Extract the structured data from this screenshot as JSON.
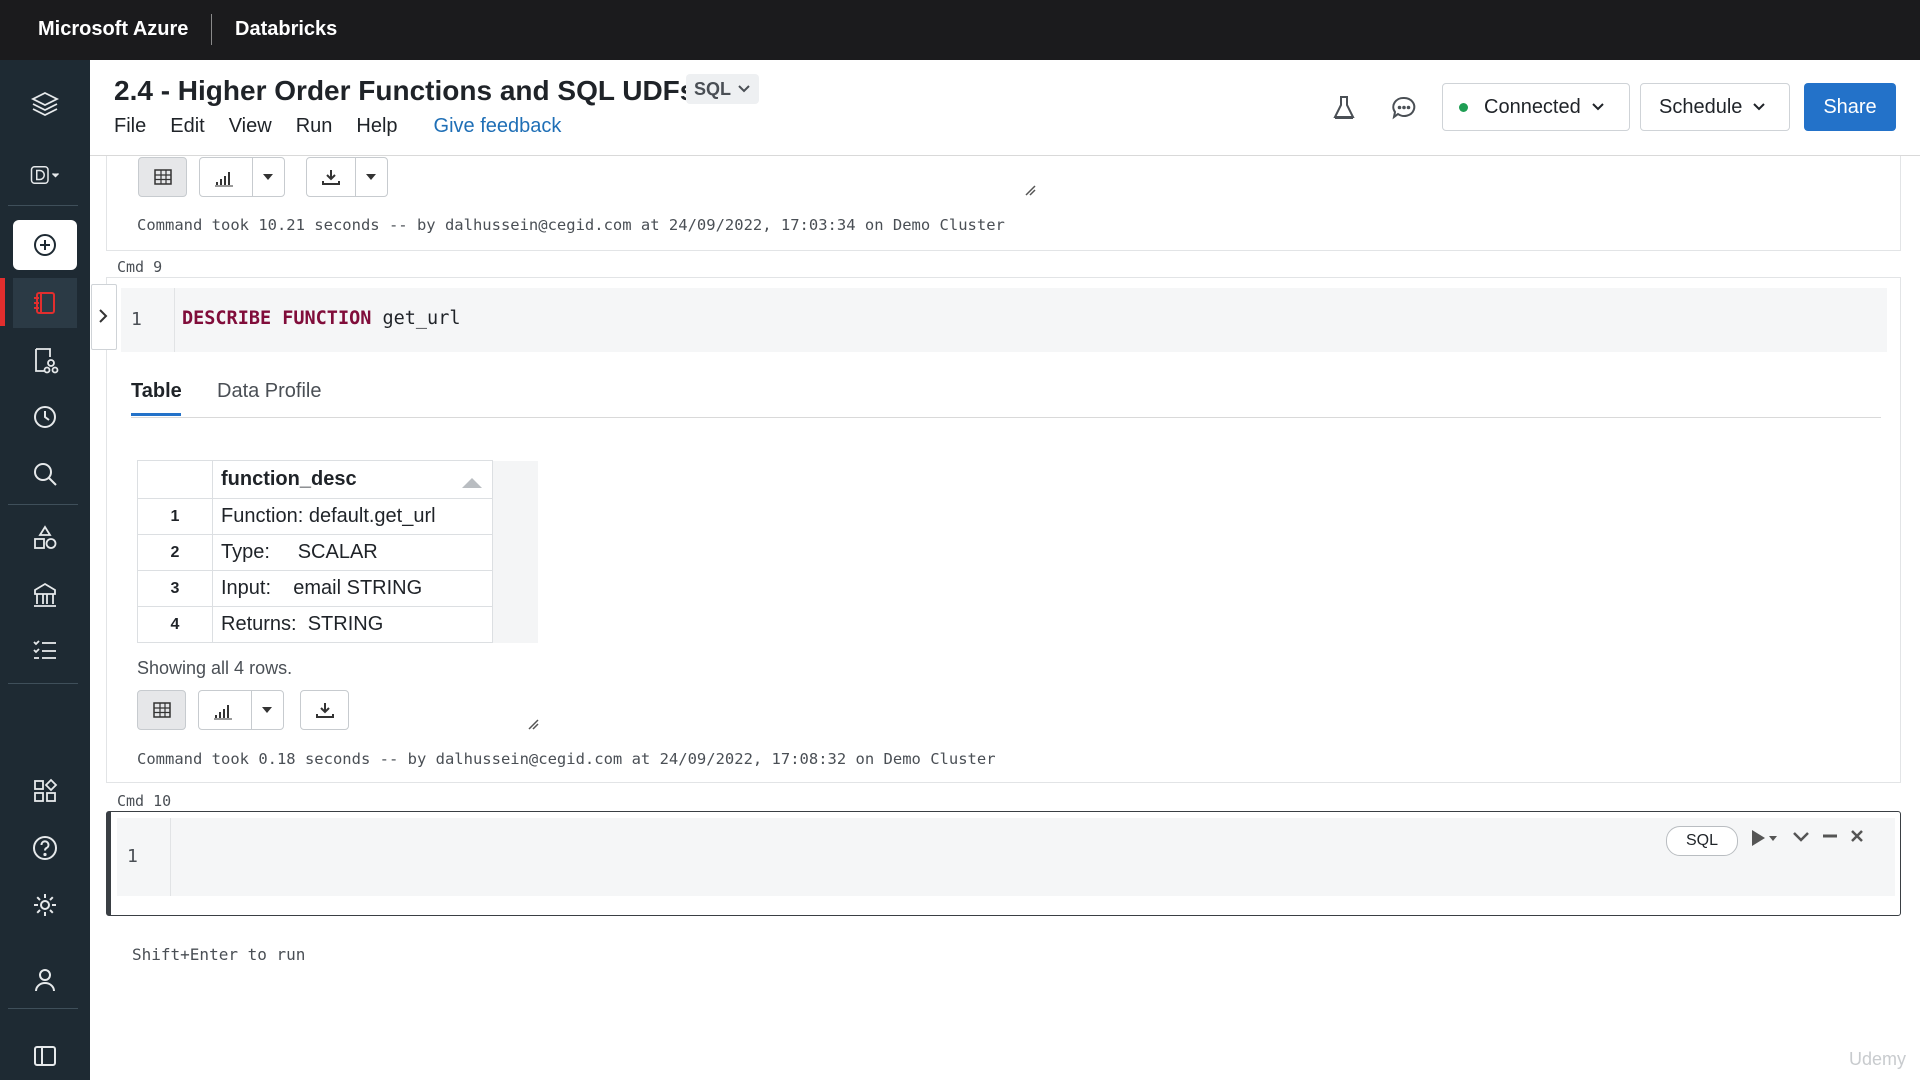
{
  "topbar": {
    "left_brand": "Microsoft Azure",
    "right_brand": "Databricks"
  },
  "sidebar": {
    "items": [
      {
        "name": "workspace-logo-icon"
      },
      {
        "name": "workspace-switcher-icon"
      },
      {
        "name": "create-icon"
      },
      {
        "name": "notebook-icon"
      },
      {
        "name": "repos-icon"
      },
      {
        "name": "recents-icon"
      },
      {
        "name": "search-icon"
      },
      {
        "name": "data-icon"
      },
      {
        "name": "compute-icon"
      },
      {
        "name": "workflows-icon"
      },
      {
        "name": "partner-connect-icon"
      },
      {
        "name": "help-icon"
      },
      {
        "name": "settings-icon"
      },
      {
        "name": "user-icon"
      },
      {
        "name": "collapse-sidebar-icon"
      }
    ]
  },
  "header": {
    "title": "2.4 - Higher Order Functions and SQL UDFs",
    "language": "SQL",
    "menu": [
      "File",
      "Edit",
      "View",
      "Run",
      "Help"
    ],
    "feedback": "Give feedback",
    "connected": "Connected",
    "schedule": "Schedule",
    "share": "Share"
  },
  "cell8": {
    "took": "Command took 10.21 seconds -- by dalhussein@cegid.com at 24/09/2022, 17:03:34 on Demo Cluster"
  },
  "cell9": {
    "label": "Cmd 9",
    "line_number": "1",
    "code_keywords": [
      "DESCRIBE",
      "FUNCTION"
    ],
    "code_rest": "get_url",
    "tabs": [
      "Table",
      "Data Profile"
    ],
    "table": {
      "column": "function_desc",
      "rows": [
        {
          "n": "1",
          "value": "Function: default.get_url"
        },
        {
          "n": "2",
          "value": "Type:     SCALAR"
        },
        {
          "n": "3",
          "value": "Input:    email STRING"
        },
        {
          "n": "4",
          "value": "Returns:  STRING"
        }
      ]
    },
    "row_count": "Showing all 4 rows.",
    "took": "Command took 0.18 seconds -- by dalhussein@cegid.com at 24/09/2022, 17:08:32 on Demo Cluster"
  },
  "cell10": {
    "label": "Cmd 10",
    "line_number": "1",
    "language": "SQL",
    "hint": "Shift+Enter to run"
  },
  "watermark": "Udemy"
}
